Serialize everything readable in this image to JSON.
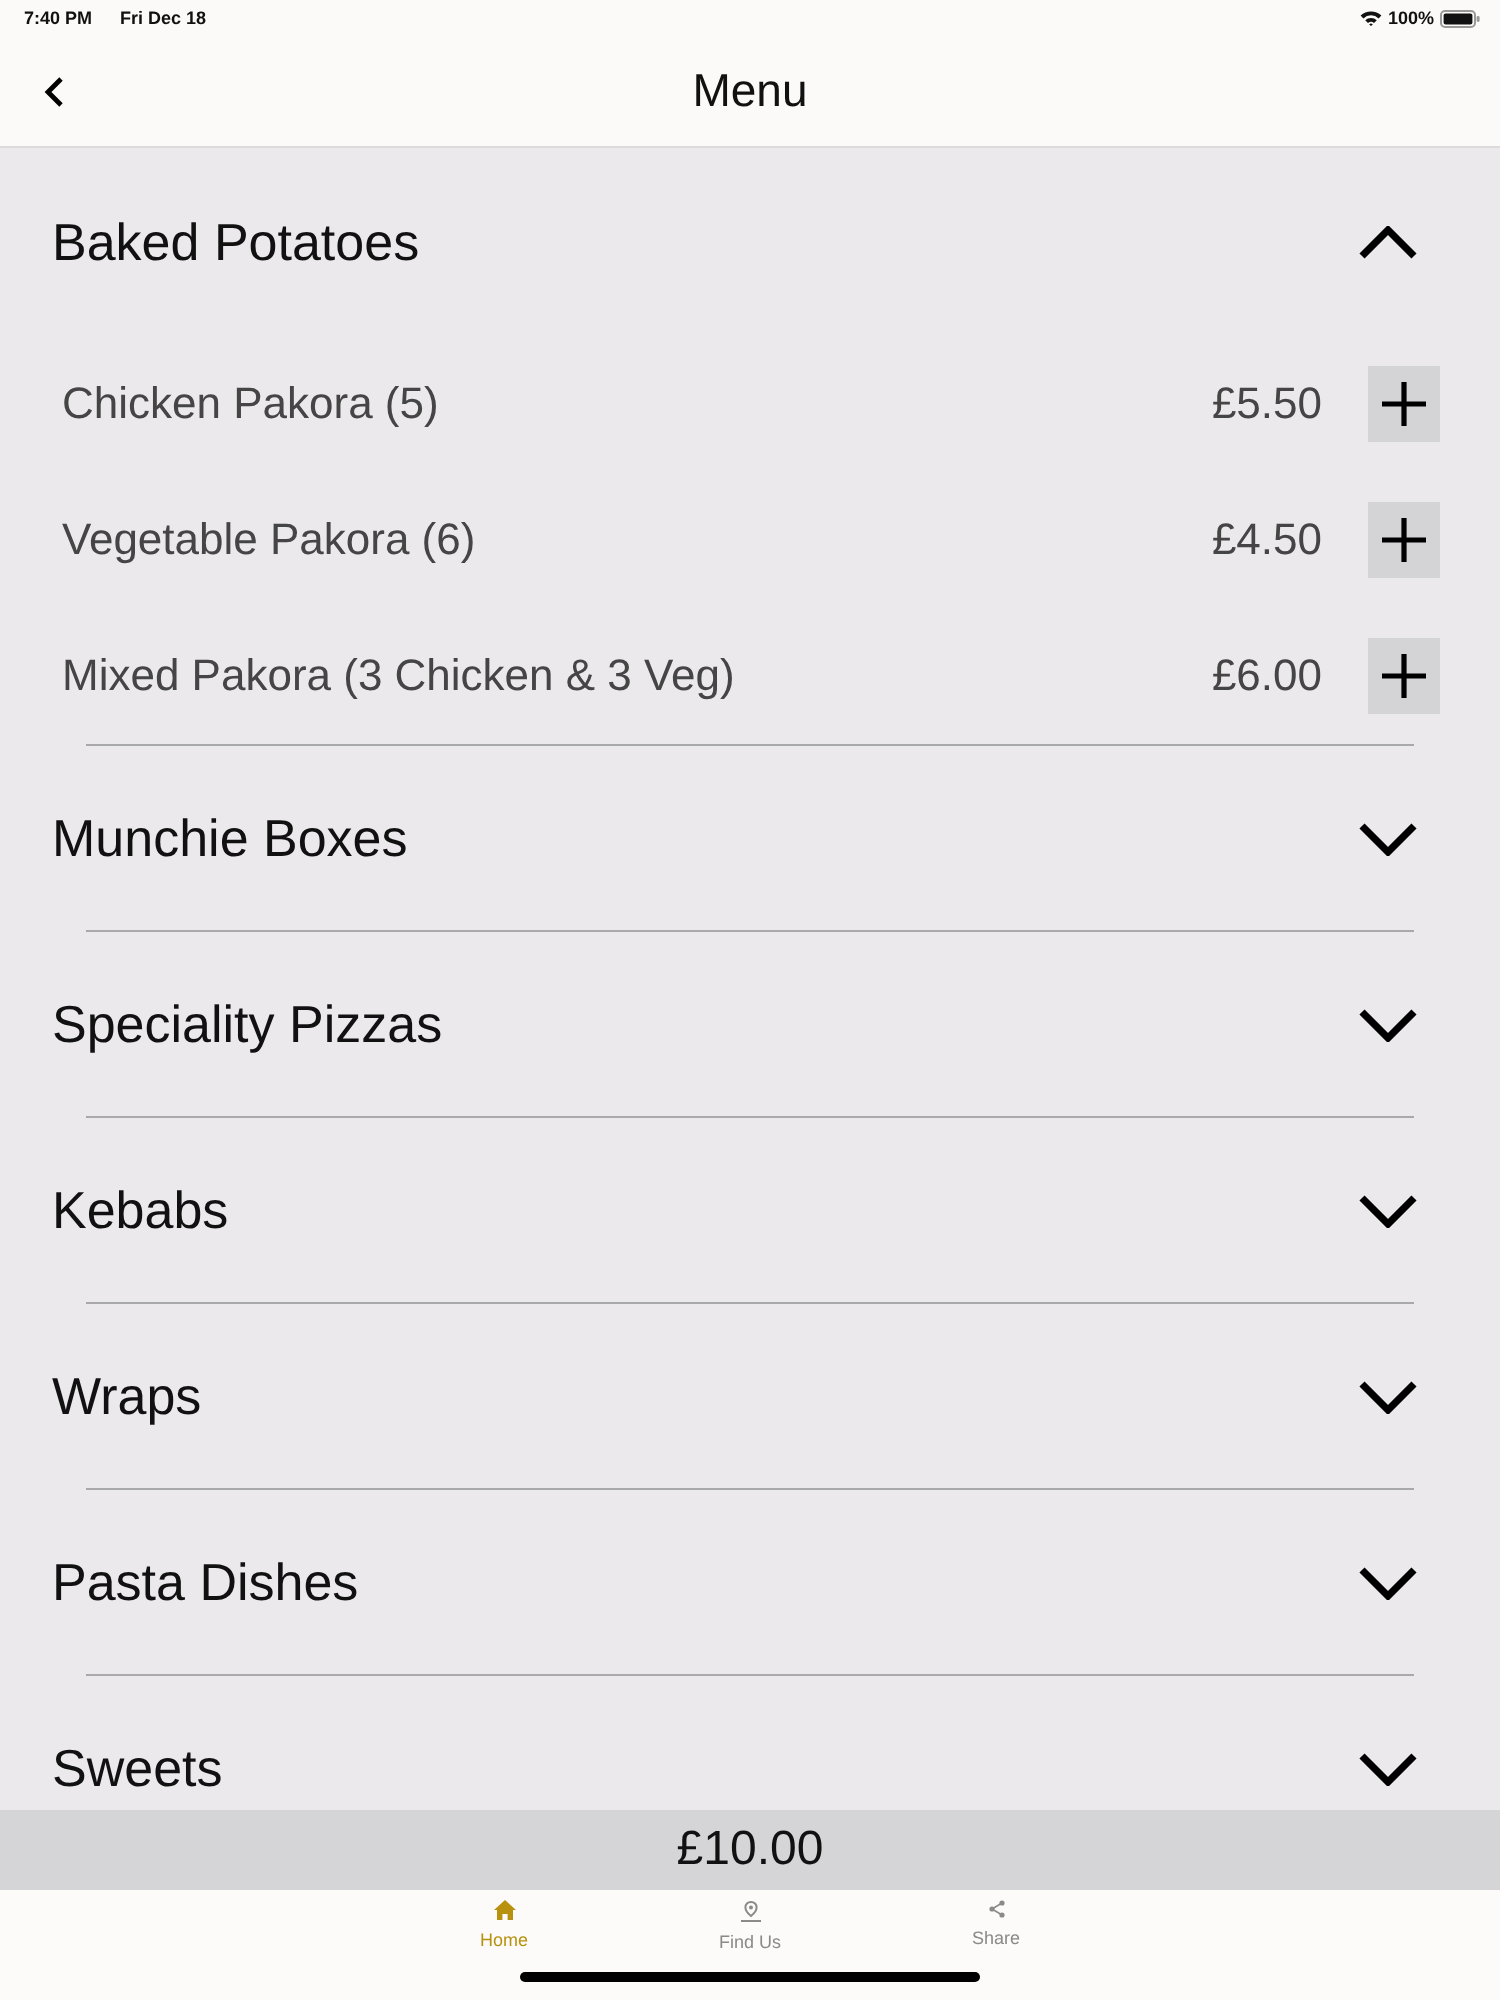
{
  "status_bar": {
    "time": "7:40 PM",
    "date": "Fri Dec 18",
    "battery": "100%"
  },
  "nav_bar": {
    "title": "Menu"
  },
  "categories": [
    {
      "name": "Baked Potatoes",
      "expanded": true,
      "items": [
        {
          "name": "Chicken Pakora (5)",
          "price": "£5.50"
        },
        {
          "name": "Vegetable Pakora (6)",
          "price": "£4.50"
        },
        {
          "name": "Mixed Pakora (3 Chicken & 3 Veg)",
          "price": "£6.00"
        }
      ]
    },
    {
      "name": "Munchie Boxes",
      "expanded": false
    },
    {
      "name": "Speciality Pizzas",
      "expanded": false
    },
    {
      "name": "Kebabs",
      "expanded": false
    },
    {
      "name": "Wraps",
      "expanded": false
    },
    {
      "name": "Pasta Dishes",
      "expanded": false
    },
    {
      "name": "Sweets",
      "expanded": false
    }
  ],
  "total": "£10.00",
  "tab_bar": [
    {
      "label": "Home",
      "kind": "home",
      "selected": true
    },
    {
      "label": "Find Us",
      "kind": "pin",
      "selected": false
    },
    {
      "label": "Share",
      "kind": "share",
      "selected": false
    }
  ]
}
